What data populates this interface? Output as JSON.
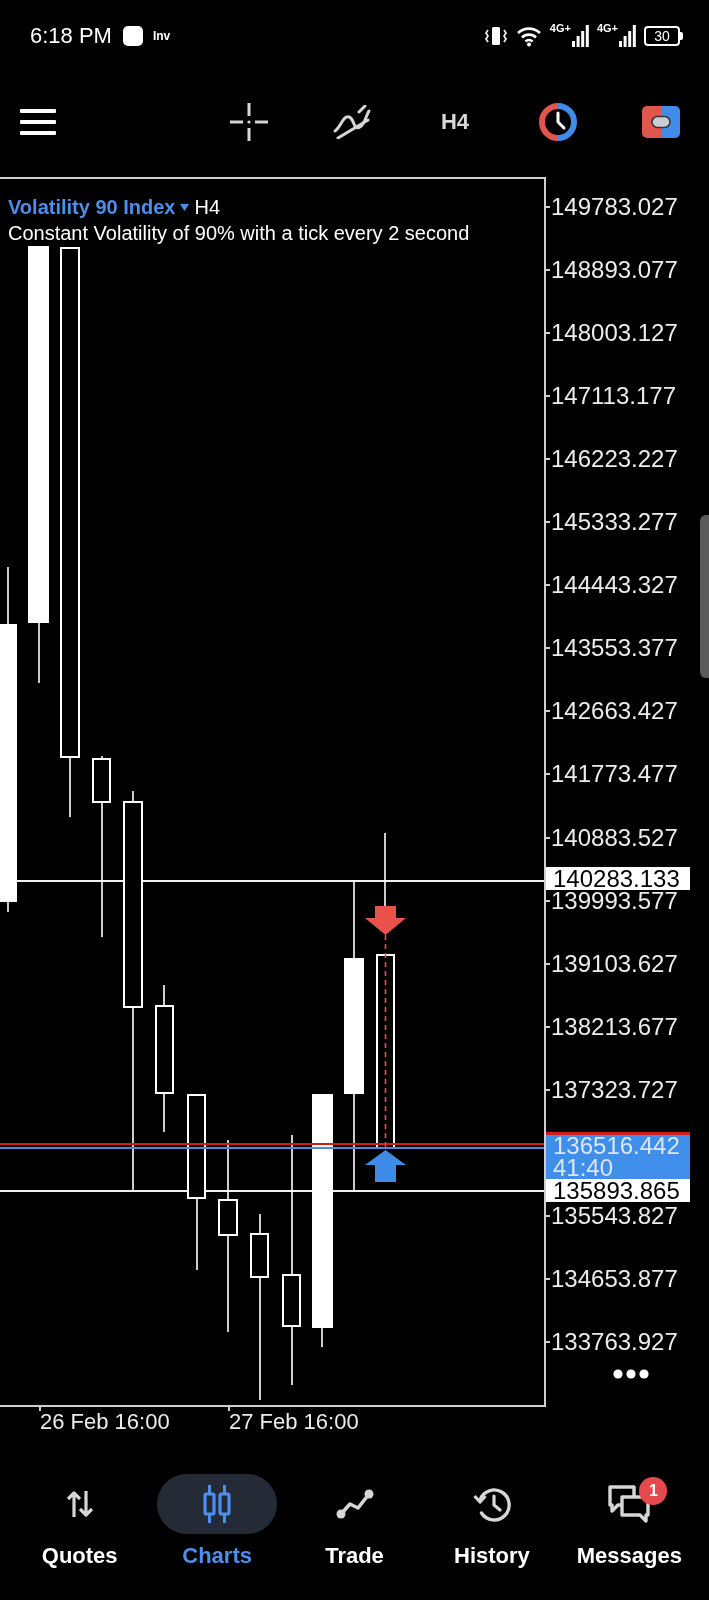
{
  "status_bar": {
    "time": "6:18 PM",
    "notification_logo": "Inv",
    "networks": [
      {
        "label": "4G+"
      },
      {
        "label": "4G+"
      }
    ],
    "battery": "30"
  },
  "toolbar": {
    "timeframe": "H4"
  },
  "chart": {
    "symbol": "Volatility 90 Index",
    "timeframe": "H4",
    "description": "Constant Volatility of 90% with a tick every 2 second",
    "price_ticks": [
      "149783.027",
      "148893.077",
      "148003.127",
      "147113.177",
      "146223.227",
      "145333.277",
      "144443.327",
      "143553.377",
      "142663.427",
      "141773.477",
      "140883.527",
      "139993.577",
      "139103.627",
      "138213.677",
      "137323.727",
      "135543.827",
      "134653.877",
      "133763.927"
    ],
    "price_tags": [
      {
        "kind": "level",
        "text": "140283.133"
      },
      {
        "kind": "current",
        "text": "136516.442",
        "countdown": "41:40"
      },
      {
        "kind": "level",
        "text": "135893.865"
      }
    ],
    "time_ticks": [
      "26 Feb 16:00",
      "27 Feb 16:00"
    ]
  },
  "nav": [
    {
      "label": "Quotes",
      "selected": false
    },
    {
      "label": "Charts",
      "selected": true
    },
    {
      "label": "Trade",
      "selected": false
    },
    {
      "label": "History",
      "selected": false
    },
    {
      "label": "Messages",
      "selected": false,
      "badge": "1"
    }
  ]
}
